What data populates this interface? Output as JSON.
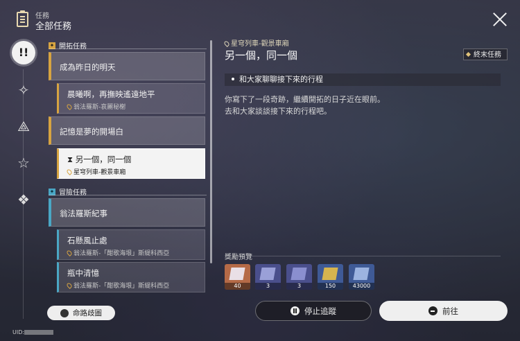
{
  "header": {
    "small_label": "任務",
    "title": "全部任務"
  },
  "nav": {
    "items": [
      "exclamation-icon",
      "diamond-star-icon",
      "triangle-star-icon",
      "star-icon",
      "diamond-icon"
    ]
  },
  "sections": {
    "trailblaze": {
      "label": "開拓任務"
    },
    "adventure": {
      "label": "冒險任務"
    }
  },
  "quests": {
    "q1": {
      "title": "成為昨日的明天"
    },
    "q2": {
      "title": "晨曦啊，再撫映遙遠地平",
      "location": "翁法羅斯-哀麗秘榭"
    },
    "q3": {
      "title": "記憶是夢的開場白"
    },
    "q4": {
      "title": "另一個，同一個",
      "location": "星穹列車-觀景車廂"
    },
    "q5": {
      "title": "翁法羅斯紀事"
    },
    "q6": {
      "title": "石懸風止處",
      "location": "翁法羅斯-「酣歌海垠」斯緹科西亞"
    },
    "q7": {
      "title": "瓶中清憶",
      "location": "翁法羅斯-「酣歌海垠」斯緹科西亞"
    }
  },
  "detail": {
    "location": "星穹列車-觀景車廂",
    "title": "另一個，同一個",
    "badge": "終末任務",
    "objective": "和大家聊聊接下來的行程",
    "desc1": "你寫下了一段奇跡，繼續開拓的日子近在眼前。",
    "desc2": "去和大家談談接下來的行程吧。"
  },
  "rewards": {
    "label": "獎勵預覽",
    "items": [
      {
        "count": "40",
        "color": "#b56a47"
      },
      {
        "count": "3",
        "color": "#4a4f8c"
      },
      {
        "count": "3",
        "color": "#4a4f8c"
      },
      {
        "count": "150",
        "color": "#3f5a96"
      },
      {
        "count": "43000",
        "color": "#3f5a96"
      }
    ]
  },
  "buttons": {
    "route": "命路歧圖",
    "stop": "停止追蹤",
    "go": "前往"
  },
  "uid_label": "UID:"
}
